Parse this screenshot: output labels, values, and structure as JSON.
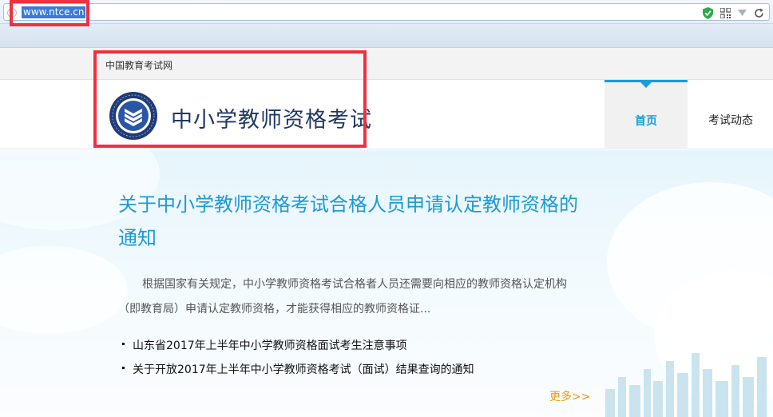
{
  "browser": {
    "url": "www.ntce.cn"
  },
  "site": {
    "name": "中国教育考试网",
    "logo_title": "中小学教师资格考试"
  },
  "nav": {
    "home": "首页",
    "news": "考试动态"
  },
  "notice": {
    "title": "关于中小学教师资格考试合格人员申请认定教师资格的通知",
    "summary": "根据国家有关规定，中小学教师资格考试合格者人员还需要向相应的教师资格认定机构（即教育局）申请认定教师资格，才能获得相应的教师资格证..."
  },
  "news_items": [
    "山东省2017年上半年中小学教师资格面试考生注意事项",
    "关于开放2017年上半年中小学教师资格考试（面试）结果查询的通知"
  ],
  "more_label": "更多>>",
  "colors": {
    "accent": "#1d9ad6",
    "highlight": "#ee3040",
    "more": "#f39800",
    "logo_navy": "#1f3864"
  },
  "icons": [
    "globe-icon",
    "shield-icon",
    "qr-code-icon",
    "dropdown-icon",
    "refresh-icon",
    "logo-emblem"
  ]
}
